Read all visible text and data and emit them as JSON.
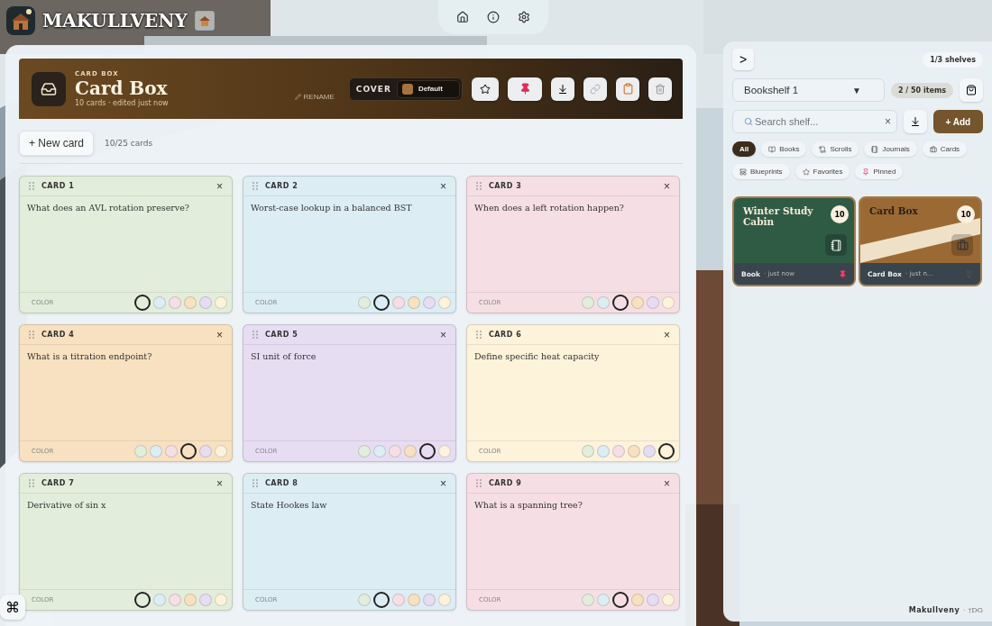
{
  "app": {
    "title": "MAKULLVENY"
  },
  "nav": [
    {
      "kind": "home"
    },
    {
      "kind": "info"
    },
    {
      "kind": "settings"
    }
  ],
  "box": {
    "eyebrow": "CARD BOX",
    "title": "Card Box",
    "subtitle": "10 cards · edited just now",
    "rename": "RENAME",
    "cover_label": "COVER",
    "cover_value": "Default",
    "pinned": true
  },
  "toolbar": {
    "new_card": "+ New card",
    "count": "10/25 cards"
  },
  "cards": [
    {
      "title": "CARD 1",
      "close": "×",
      "text": "What does an AVL rotation preserve?",
      "color_label": "COLOR",
      "swatches": [
        {
          "color": "#e2eedb",
          "selected": true
        },
        {
          "color": "#dcedf4",
          "selected": false
        },
        {
          "color": "#f6dfe4",
          "selected": false
        },
        {
          "color": "#f7e1c0",
          "selected": false
        },
        {
          "color": "#e7ddf3",
          "selected": false
        },
        {
          "color": "#fdf2da",
          "selected": false
        }
      ]
    },
    {
      "title": "CARD 2",
      "close": "×",
      "text": "Worst-case lookup in a balanced BST",
      "color_label": "COLOR",
      "swatches": [
        {
          "color": "#e2eedb",
          "selected": false
        },
        {
          "color": "#dcedf4",
          "selected": true
        },
        {
          "color": "#f6dfe4",
          "selected": false
        },
        {
          "color": "#f7e1c0",
          "selected": false
        },
        {
          "color": "#e7ddf3",
          "selected": false
        },
        {
          "color": "#fdf2da",
          "selected": false
        }
      ]
    },
    {
      "title": "CARD 3",
      "close": "×",
      "text": "When does a left rotation happen?",
      "color_label": "COLOR",
      "swatches": [
        {
          "color": "#e2eedb",
          "selected": false
        },
        {
          "color": "#dcedf4",
          "selected": false
        },
        {
          "color": "#f6dfe4",
          "selected": true
        },
        {
          "color": "#f7e1c0",
          "selected": false
        },
        {
          "color": "#e7ddf3",
          "selected": false
        },
        {
          "color": "#fdf2da",
          "selected": false
        }
      ]
    },
    {
      "title": "CARD 4",
      "close": "×",
      "text": "What is a titration endpoint?",
      "color_label": "COLOR",
      "swatches": [
        {
          "color": "#e2eedb",
          "selected": false
        },
        {
          "color": "#dcedf4",
          "selected": false
        },
        {
          "color": "#f6dfe4",
          "selected": false
        },
        {
          "color": "#f7e1c0",
          "selected": true
        },
        {
          "color": "#e7ddf3",
          "selected": false
        },
        {
          "color": "#fdf2da",
          "selected": false
        }
      ]
    },
    {
      "title": "CARD 5",
      "close": "×",
      "text": "SI unit of force",
      "color_label": "COLOR",
      "swatches": [
        {
          "color": "#e2eedb",
          "selected": false
        },
        {
          "color": "#dcedf4",
          "selected": false
        },
        {
          "color": "#f6dfe4",
          "selected": false
        },
        {
          "color": "#f7e1c0",
          "selected": false
        },
        {
          "color": "#e7ddf3",
          "selected": true
        },
        {
          "color": "#fdf2da",
          "selected": false
        }
      ]
    },
    {
      "title": "CARD 6",
      "close": "×",
      "text": "Define specific heat capacity",
      "color_label": "COLOR",
      "swatches": [
        {
          "color": "#e2eedb",
          "selected": false
        },
        {
          "color": "#dcedf4",
          "selected": false
        },
        {
          "color": "#f6dfe4",
          "selected": false
        },
        {
          "color": "#f7e1c0",
          "selected": false
        },
        {
          "color": "#e7ddf3",
          "selected": false
        },
        {
          "color": "#fdf2da",
          "selected": true
        }
      ]
    },
    {
      "title": "CARD 7",
      "close": "×",
      "text": "Derivative of sin x",
      "color_label": "COLOR",
      "swatches": [
        {
          "color": "#e2eedb",
          "selected": true
        },
        {
          "color": "#dcedf4",
          "selected": false
        },
        {
          "color": "#f6dfe4",
          "selected": false
        },
        {
          "color": "#f7e1c0",
          "selected": false
        },
        {
          "color": "#e7ddf3",
          "selected": false
        },
        {
          "color": "#fdf2da",
          "selected": false
        }
      ]
    },
    {
      "title": "CARD 8",
      "close": "×",
      "text": "State Hookes law",
      "color_label": "COLOR",
      "swatches": [
        {
          "color": "#e2eedb",
          "selected": false
        },
        {
          "color": "#dcedf4",
          "selected": true
        },
        {
          "color": "#f6dfe4",
          "selected": false
        },
        {
          "color": "#f7e1c0",
          "selected": false
        },
        {
          "color": "#e7ddf3",
          "selected": false
        },
        {
          "color": "#fdf2da",
          "selected": false
        }
      ]
    },
    {
      "title": "CARD 9",
      "close": "×",
      "text": "What is a spanning tree?",
      "color_label": "COLOR",
      "swatches": [
        {
          "color": "#e2eedb",
          "selected": false
        },
        {
          "color": "#dcedf4",
          "selected": false
        },
        {
          "color": "#f6dfe4",
          "selected": true
        },
        {
          "color": "#f7e1c0",
          "selected": false
        },
        {
          "color": "#e7ddf3",
          "selected": false
        },
        {
          "color": "#fdf2da",
          "selected": false
        }
      ]
    }
  ],
  "shelf": {
    "collapse": ">",
    "shelves": "1/3 shelves",
    "name": "Bookshelf 1",
    "caret": "▼",
    "items_count": "2 / 50 items",
    "search": {
      "placeholder": "Search shelf...",
      "clear": "×"
    },
    "add": "+ Add",
    "filters": [
      {
        "label": "All",
        "kind": "all",
        "selected": true
      },
      {
        "label": "Books",
        "kind": "book",
        "selected": false
      },
      {
        "label": "Scrolls",
        "kind": "scroll",
        "selected": false
      },
      {
        "label": "Journals",
        "kind": "journal",
        "selected": false
      },
      {
        "label": "Cards",
        "kind": "cards",
        "selected": false
      },
      {
        "label": "Blueprints",
        "kind": "blueprint",
        "selected": false
      },
      {
        "label": "Favorites",
        "kind": "favorite",
        "selected": false
      },
      {
        "label": "Pinned",
        "kind": "pinned",
        "selected": false
      }
    ],
    "items": [
      {
        "title": "Winter Study Cabin",
        "badge": "10",
        "kind": "book",
        "type": "Book",
        "time": "· just now",
        "pinned": true
      },
      {
        "title": "Card Box",
        "badge": "10",
        "kind": "cards",
        "type": "Card Box",
        "time": "· just n...",
        "pinned": false
      }
    ]
  },
  "footer": {
    "brand": "Makullveny",
    "mark": "· †DG"
  },
  "shortcut": "⌘"
}
